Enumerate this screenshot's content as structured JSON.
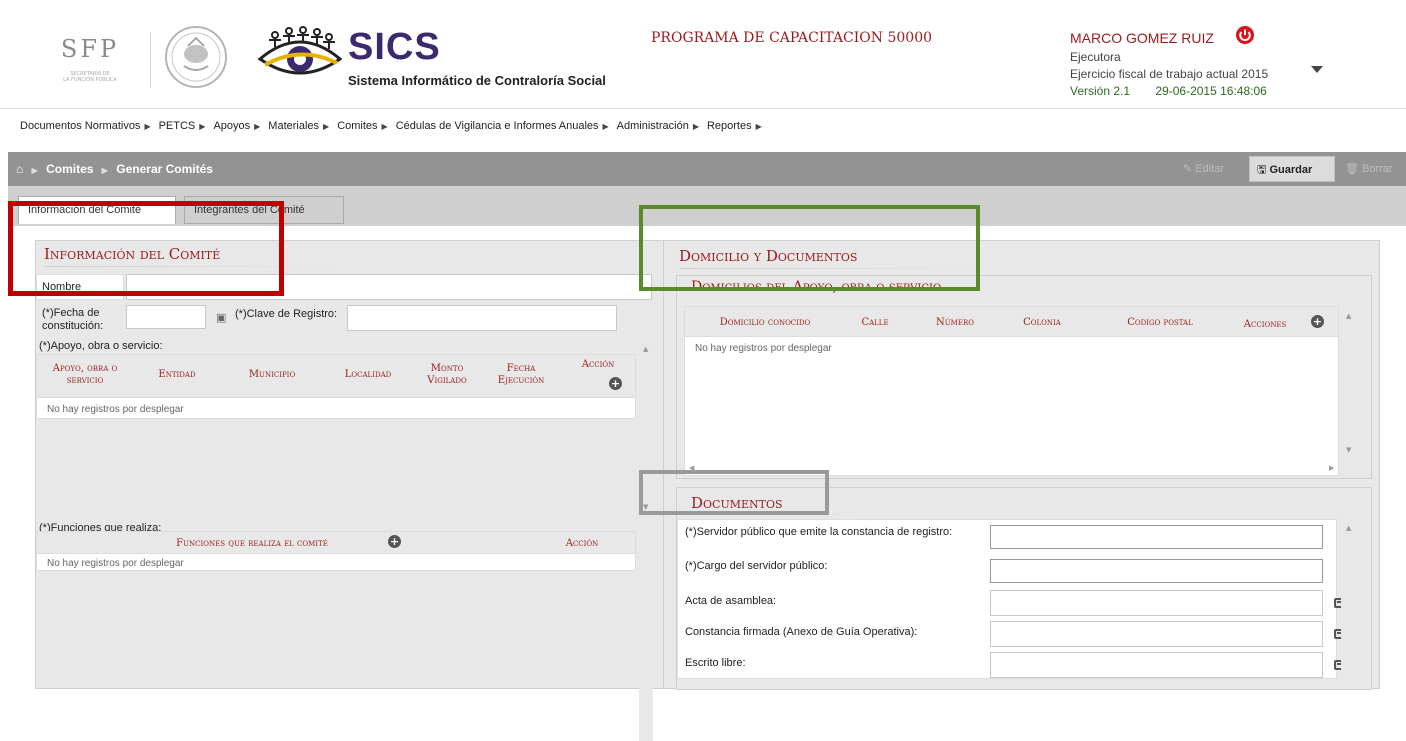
{
  "header": {
    "sfp_logo_text": "SFP",
    "sfp_logo_sub1": "SECRETARÍA DE",
    "sfp_logo_sub2": "LA FUNCIÓN PÚBLICA",
    "app_name": "SICS",
    "app_subtitle": "Sistema Informático de Contraloría Social",
    "program": "PROGRAMA DE CAPACITACION 50000",
    "user_name": "MARCO GOMEZ RUIZ",
    "user_role": "Ejecutora",
    "fiscal_year": "Ejercicio fiscal de trabajo actual  2015",
    "version": "Versión 2.1",
    "datetime": "29-06-2015 16:48:06"
  },
  "menu": [
    "Documentos Normativos",
    "PETCS",
    "Apoyos",
    "Materiales",
    "Comites",
    "Cédulas de Vigilancia e Informes Anuales",
    "Administración",
    "Reportes"
  ],
  "breadcrumb": {
    "level1": "Comites",
    "level2": "Generar Comités"
  },
  "toolbar": {
    "edit": "Editar",
    "save": "Guardar",
    "delete": "Borrar"
  },
  "tabs": [
    "Información del Comité",
    "Integrantes del Comité"
  ],
  "left": {
    "title": "Información del Comité",
    "nombre_label": "Nombre",
    "fecha_label_1": "(*)Fecha de",
    "fecha_label_2": "constitución:",
    "clave_label": "(*)Clave de Registro:",
    "apoyo_label": "(*)Apoyo, obra o servicio:",
    "apoyo_table_headers": [
      "Apoyo, obra o servicio",
      "Entidad",
      "Municipio",
      "Localidad",
      "Monto Vigilado",
      "Fecha Ejecución",
      "Acción"
    ],
    "empty": "No hay registros por desplegar",
    "funciones_label": "(*)Funciones que realiza:",
    "funciones_table_headers": [
      "Funciones que realiza el comité",
      "Acción"
    ]
  },
  "right": {
    "title": "Domicilio y Documentos",
    "domicilios_title": "Domicilios del Apoyo, obra o servicio",
    "domicilios_headers": [
      "Domicilio conocido",
      "Calle",
      "Número",
      "Colonia",
      "Codigo postal",
      "Acciones"
    ],
    "empty": "No hay registros por desplegar",
    "documentos_title": "Documentos",
    "doc_rows": [
      "(*)Servidor público que emite la constancia de registro:",
      "(*)Cargo del servidor público:",
      "Acta de asamblea:",
      "Constancia firmada (Anexo de Guía Operativa):",
      "Escrito libre:"
    ]
  },
  "colors": {
    "accent_red": "#9b1a1a",
    "brand_purple": "#3b2a6e",
    "version_green": "#2e6a1f",
    "annotation_red": "#c00000",
    "annotation_green": "#5a8a2a",
    "annotation_gray": "#9a9a9a"
  }
}
